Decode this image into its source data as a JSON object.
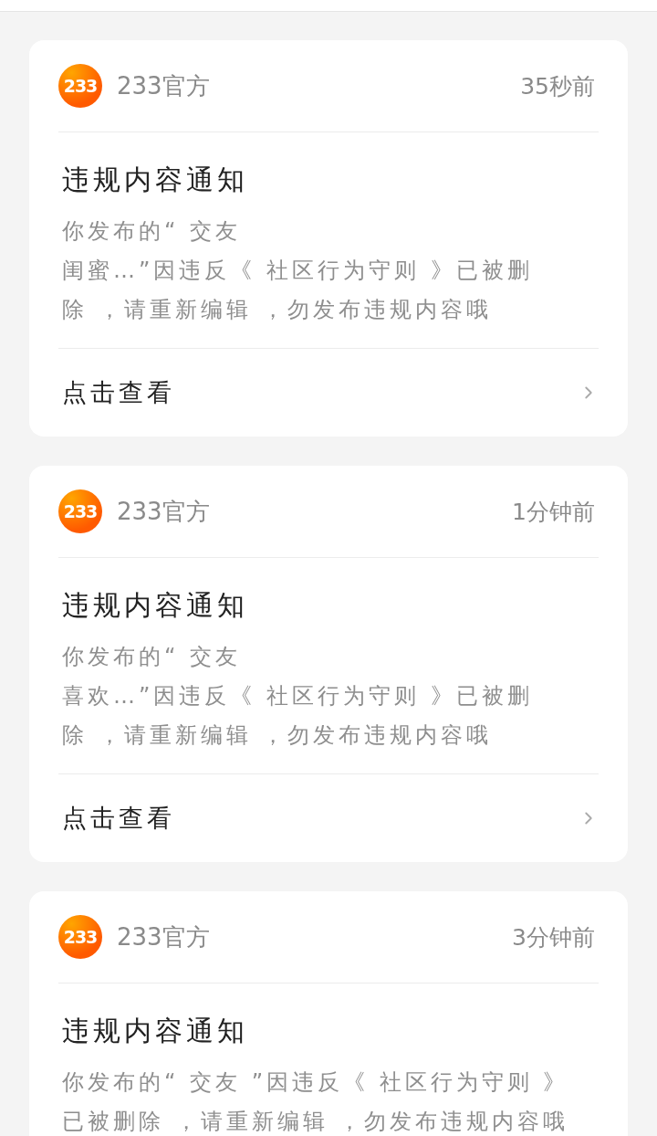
{
  "notifications": [
    {
      "avatar_text": "233",
      "sender": "233官方",
      "time": "35秒前",
      "title": "违规内容通知",
      "body_lines": [
        "你发布的“ 交友",
        "闺蜜…”因违反《 社区行为守则 》已被删",
        "除 ，请重新编辑 ，勿发布违规内容哦"
      ],
      "action": "点击查看"
    },
    {
      "avatar_text": "233",
      "sender": "233官方",
      "time": "1分钟前",
      "title": "违规内容通知",
      "body_lines": [
        "你发布的“ 交友",
        "喜欢…”因违反《 社区行为守则 》已被删",
        "除 ，请重新编辑 ，勿发布违规内容哦"
      ],
      "action": "点击查看"
    },
    {
      "avatar_text": "233",
      "sender": "233官方",
      "time": "3分钟前",
      "title": "违规内容通知",
      "body_lines": [
        "你发布的“ 交友 ”因违反《 社区行为守则 》",
        "已被删除 ，请重新编辑 ，勿发布违规内容哦"
      ]
    }
  ]
}
